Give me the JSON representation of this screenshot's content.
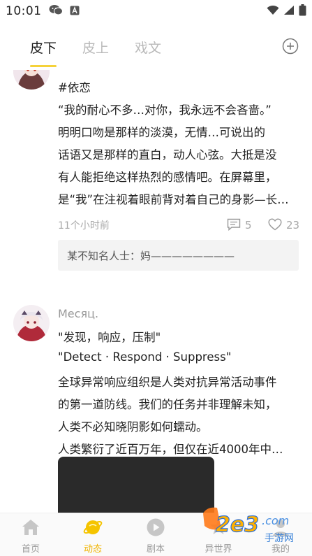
{
  "status_bar": {
    "time": "10:01"
  },
  "tabs": [
    {
      "label": "皮下",
      "active": true
    },
    {
      "label": "皮上",
      "active": false
    },
    {
      "label": "戏文",
      "active": false
    }
  ],
  "colors": {
    "accent": "#f5d23a",
    "active_nav": "#f0b400"
  },
  "posts": [
    {
      "lines": [
        "#依恋",
        "    “我的耐心不多…对你，我永远不会吝啬。”",
        "    明明口吻是那样的淡漠，无情…可说出的",
        "话语又是那样的直白，动人心弦。大抵是没",
        "有人能拒绝这样热烈的感情吧。在屏幕里，",
        "是“我”在注视着眼前背对着自己的身影—长…"
      ],
      "time": "11个小时前",
      "comments": "5",
      "likes": "23",
      "comment_preview": "某不知名人士：妈————————"
    },
    {
      "username": "Месяц.",
      "lines": [
        "\"发现，响应，压制\"",
        "\"Detect · Respond · Suppress\"",
        "全球异常响应组织是人类对抗异常活动事件",
        "的第一道防线。我们的任务并非理解未知，",
        "人类不必知晓阴影如何蠕动。",
        "人类繁衍了近百万年，但仅在近4000年中…"
      ]
    }
  ],
  "bottom_nav": [
    {
      "label": "首页",
      "icon": "home-icon",
      "active": false
    },
    {
      "label": "动态",
      "icon": "planet-icon",
      "active": true
    },
    {
      "label": "剧本",
      "icon": "play-icon",
      "active": false
    },
    {
      "label": "异世界",
      "icon": "world-icon",
      "active": false
    },
    {
      "label": "我的",
      "icon": "profile-icon",
      "active": false
    }
  ],
  "watermark": {
    "logo_text": "2e3",
    "suffix": ".com",
    "caption": "手游网"
  }
}
